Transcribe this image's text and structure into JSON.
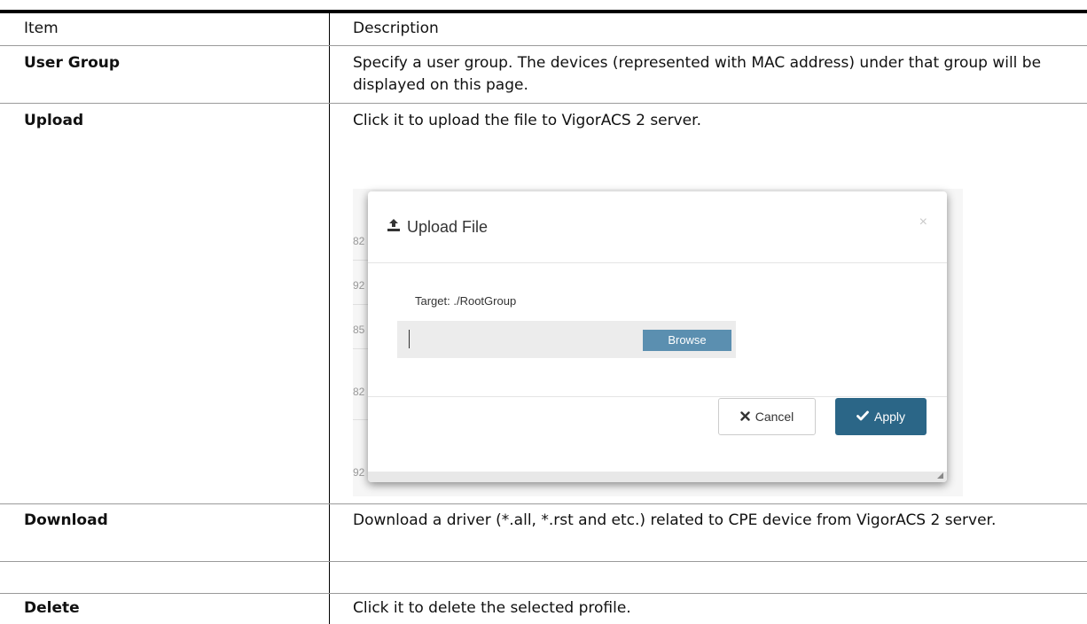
{
  "table": {
    "header": {
      "item": "Item",
      "description": "Description"
    },
    "rows": [
      {
        "item": "User Group",
        "description": "Specify a user group. The devices (represented with MAC address) under that group will be displayed on this page."
      },
      {
        "item": "Upload",
        "description": "Click it to upload the file to VigorACS 2 server."
      },
      {
        "item": "Download",
        "description": "Download a driver (*.all, *.rst and etc.) related to CPE device from VigorACS 2 server."
      },
      {
        "item": "Delete",
        "description": "Click it to delete the selected profile."
      }
    ]
  },
  "dialog": {
    "title": "Upload File",
    "close_glyph": "×",
    "target_label": "Target: ./RootGroup",
    "browse_label": "Browse",
    "cancel_label": "Cancel",
    "apply_label": "Apply",
    "background_numbers": [
      "82",
      "92",
      "85",
      "82",
      "92"
    ],
    "icons": {
      "title": "upload-icon",
      "cancel": "times-icon",
      "apply": "check-icon"
    },
    "colors": {
      "apply": "#2b6687",
      "browse": "#5b8fb0"
    }
  }
}
